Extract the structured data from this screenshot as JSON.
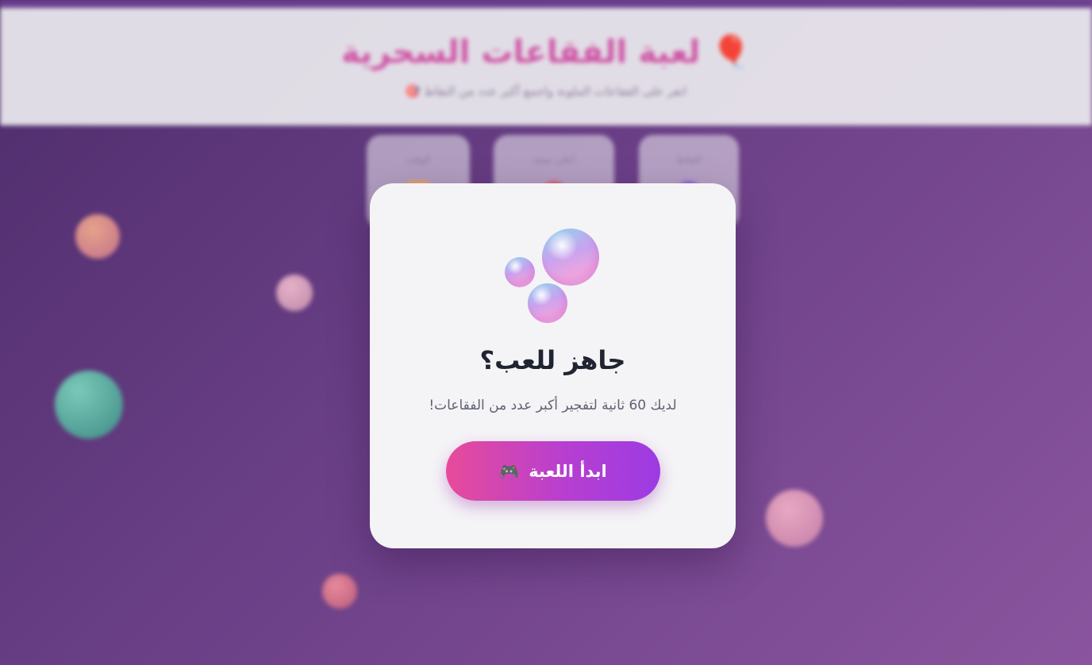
{
  "header": {
    "title": "🎈 لعبة الفقاعات السحرية",
    "subtitle": "انقر على الفقاعات الملونة واجمع أكبر عدد من النقاط 🎯"
  },
  "stats": [
    {
      "label": "النقاط"
    },
    {
      "label": "أعلى نتيجة"
    },
    {
      "label": "الوقت"
    }
  ],
  "modal": {
    "title": "جاهز للعب؟",
    "description": "لديك 60 ثانية لتفجير أكبر عدد من الفقاعات!",
    "start_button_label": "ابدأ اللعبة",
    "start_button_icon": "🎮"
  },
  "colors": {
    "accent_start": "#e84b9a",
    "accent_end": "#9c3be3",
    "title_color": "#cf57a5"
  }
}
